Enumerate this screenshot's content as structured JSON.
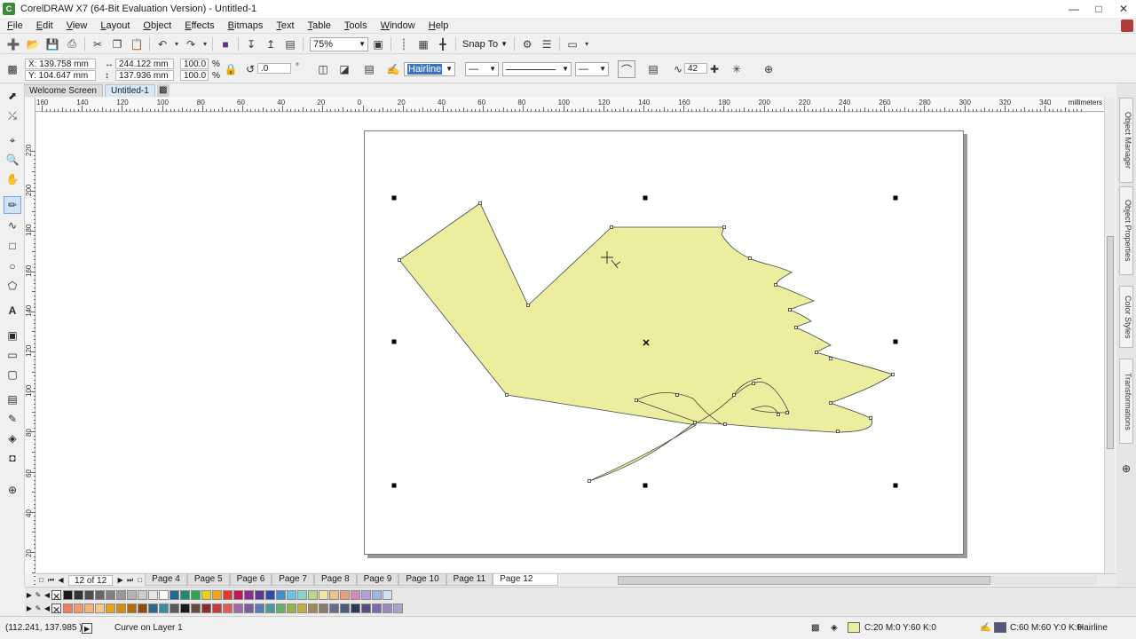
{
  "window": {
    "title": "CorelDRAW X7 (64-Bit Evaluation Version) - Untitled-1"
  },
  "menu": [
    "File",
    "Edit",
    "View",
    "Layout",
    "Object",
    "Effects",
    "Bitmaps",
    "Text",
    "Table",
    "Tools",
    "Window",
    "Help"
  ],
  "toolbar": {
    "zoom": "75%",
    "snap_label": "Snap To"
  },
  "propbar": {
    "x": "X: 139.758 mm",
    "y": "Y: 104.647 mm",
    "w": "244.122 mm",
    "h": "137.936 mm",
    "scale_x": "100.0",
    "scale_y": "100.0",
    "pct": "%",
    "rotation": ".0",
    "deg": "°",
    "outline_width": "Hairline",
    "smoothing": "42"
  },
  "doc_tabs": [
    "Welcome Screen",
    "Untitled-1"
  ],
  "ruler": {
    "unit": "millimeters",
    "h_labels": [
      "160",
      "140",
      "120",
      "100",
      "80",
      "60",
      "40",
      "20",
      "0",
      "20",
      "40",
      "60",
      "80",
      "100",
      "120",
      "140",
      "160",
      "180",
      "200",
      "220",
      "240",
      "260",
      "280",
      "300",
      "320",
      "340"
    ],
    "v_labels": [
      "220",
      "200",
      "180",
      "160",
      "140",
      "120",
      "100",
      "80",
      "60",
      "40",
      "20"
    ]
  },
  "dockers": [
    "Object Manager",
    "Object Properties",
    "Color Styles",
    "Transformations"
  ],
  "pagebar": {
    "counter": "12 of 12",
    "pages": [
      "Page 4",
      "Page 5",
      "Page 6",
      "Page 7",
      "Page 8",
      "Page 9",
      "Page 10",
      "Page 11",
      "Page 12"
    ],
    "active": "Page 12"
  },
  "palette_row1": [
    "#1a1a1a",
    "#333333",
    "#4d4d4d",
    "#666666",
    "#808080",
    "#999999",
    "#b3b3b3",
    "#cccccc",
    "#e6e6e6",
    "#ffffff",
    "#1f6b8f",
    "#1c8c6c",
    "#2aa84a",
    "#e8d21e",
    "#f7a11a",
    "#e23a2a",
    "#c2185b",
    "#8e2b8e",
    "#5b3a8e",
    "#2a4ea8",
    "#3f8fd2",
    "#6cc1e8",
    "#8ed1c6",
    "#b8d98a",
    "#f3e6a0",
    "#f2c28e",
    "#e99c8a",
    "#d48ab8",
    "#b39ddb",
    "#9fb8e6",
    "#cfe3f0"
  ],
  "palette_row2": [
    "#f27c5a",
    "#f39a6b",
    "#f5b27a",
    "#f7c98a",
    "#e8a51a",
    "#d88b12",
    "#b46b0a",
    "#8a4e08",
    "#2a6a8a",
    "#3a8aa8",
    "#5a5a5a",
    "#1a1a1a",
    "#6a4a3a",
    "#8a2a2a",
    "#c43a3a",
    "#e25a5a",
    "#a06ab0",
    "#7a5aa0",
    "#5a7ab0",
    "#4a9a9a",
    "#6ab06a",
    "#9ab04a",
    "#c0b04a",
    "#a08a5a",
    "#8a7a6a",
    "#6a6a8a",
    "#4a5a7a",
    "#2a3a5a",
    "#5a4a8a",
    "#7a6ab0",
    "#9a8ac0",
    "#b0a0d0"
  ],
  "status": {
    "coords": "(112.241, 137.985 )",
    "object_info": "Curve on Layer 1",
    "fill_color": "C:20 M:0 Y:60 K:0",
    "outline_color": "C:60 M:60 Y:0 K:0",
    "outline_width": "Hairline",
    "fill_hex": "#eaee9e",
    "outline_hex": "#55557a"
  },
  "shape": {
    "fill_hex": "#eaee9e",
    "stroke_hex": "#444444"
  }
}
